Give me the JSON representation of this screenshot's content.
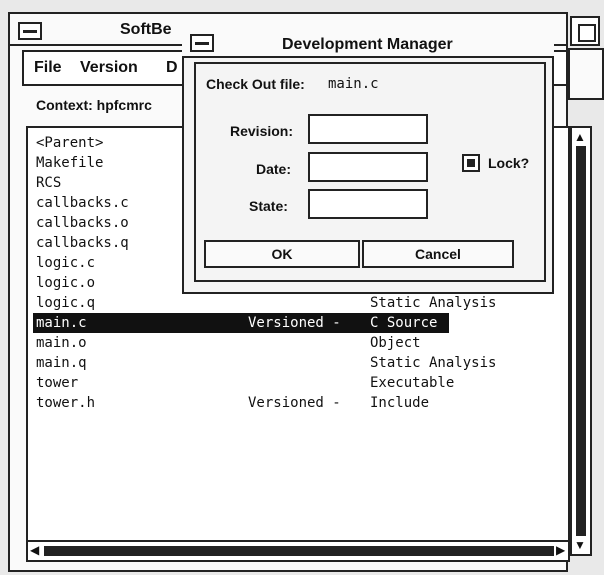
{
  "main_window": {
    "title": "SoftBe",
    "menu": [
      "File",
      "Version",
      "D"
    ],
    "context": "Context: hpfcmrc"
  },
  "dialog": {
    "title": "Development Manager",
    "checkout_label": "Check Out file:",
    "checkout_file": "main.c",
    "revision_label": "Revision:",
    "date_label": "Date:",
    "state_label": "State:",
    "revision_value": "",
    "date_value": "",
    "state_value": "",
    "lock_label": "Lock?",
    "lock_checked": true,
    "ok_label": "OK",
    "cancel_label": "Cancel"
  },
  "files": [
    {
      "name": "<Parent>",
      "status": "",
      "type": ""
    },
    {
      "name": "Makefile",
      "status": "",
      "type": ""
    },
    {
      "name": "RCS",
      "status": "",
      "type": ""
    },
    {
      "name": "callbacks.c",
      "status": "",
      "type": ""
    },
    {
      "name": "callbacks.o",
      "status": "",
      "type": ""
    },
    {
      "name": "callbacks.q",
      "status": "",
      "type": ""
    },
    {
      "name": "logic.c",
      "status": "",
      "type": ""
    },
    {
      "name": "logic.o",
      "status": "",
      "type": ""
    },
    {
      "name": "logic.q",
      "status": "",
      "type": "Static Analysis"
    },
    {
      "name": "main.c",
      "status": "Versioned -",
      "type": "C Source",
      "selected": true
    },
    {
      "name": "main.o",
      "status": "",
      "type": "Object"
    },
    {
      "name": "main.q",
      "status": "",
      "type": "Static Analysis"
    },
    {
      "name": "tower",
      "status": "",
      "type": "Executable"
    },
    {
      "name": "tower.h",
      "status": "Versioned -",
      "type": "Include"
    }
  ],
  "icons": {
    "scroll_up": "▲",
    "scroll_down": "▼",
    "scroll_left": "◀",
    "scroll_right": "▶"
  }
}
